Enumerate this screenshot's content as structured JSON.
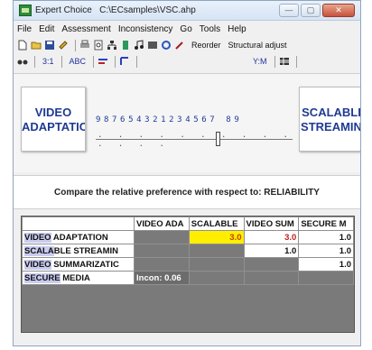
{
  "window": {
    "title": "Expert Choice   C:\\ECsamples\\VSC.ahp",
    "buttons": {
      "minimize": "—",
      "maximize": "▢",
      "close": "✕"
    }
  },
  "menu": [
    "File",
    "Edit",
    "Assessment",
    "Inconsistency",
    "Go",
    "Tools",
    "Help"
  ],
  "toolbar1": {
    "reorder": "Reorder",
    "structural_adjust": "Structural adjust"
  },
  "toolbar2": {
    "ratio": "3:1",
    "abc": "ABC",
    "ym": "Y:M"
  },
  "comparison": {
    "left_node": {
      "line1": "VIDEO",
      "line2": "ADAPTATIC"
    },
    "right_node": {
      "line1": "SCALABLI",
      "line2": "STREAMIN"
    },
    "scale_numbers": "987654321234567 89",
    "scale_value": 3
  },
  "question": "Compare the relative preference  with respect to: RELIABILITY",
  "matrix": {
    "col_headers": [
      "VIDEO ADA",
      "SCALABLE",
      "VIDEO SUM",
      "SECURE M"
    ],
    "rows": [
      {
        "label_hl": "VIDEO",
        "label_rest": " ADAPTATION",
        "cells": [
          "",
          "3.0",
          "3.0",
          "1.0"
        ]
      },
      {
        "label_hl": "SCALA",
        "label_rest": "BLE STREAMIN",
        "cells": [
          "",
          "",
          "1.0",
          "1.0"
        ]
      },
      {
        "label_hl": "VIDEO",
        "label_rest": " SUMMARIZATIC",
        "cells": [
          "",
          "",
          "",
          "1.0"
        ]
      },
      {
        "label_hl": "SECURE",
        "label_rest": " MEDIA",
        "cells": [
          "",
          "",
          "",
          ""
        ]
      }
    ],
    "inconsistency": "Incon: 0.06"
  },
  "colors": {
    "accent_blue": "#1f3a93",
    "highlight_yellow": "#ffee00",
    "grid_gray": "#7a7a7a"
  }
}
